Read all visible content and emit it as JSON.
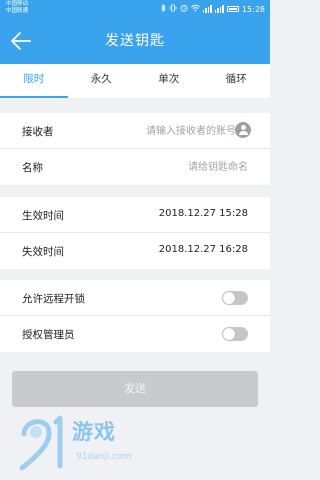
{
  "status_bar": {
    "carrier_1": "中国移动",
    "carrier_2": "中国联通",
    "time": "15:28"
  },
  "header": {
    "title": "发送钥匙",
    "back_icon": "arrow-left-icon"
  },
  "tabs": [
    {
      "label": "限时",
      "active": true
    },
    {
      "label": "永久",
      "active": false
    },
    {
      "label": "单次",
      "active": false
    },
    {
      "label": "循环",
      "active": false
    }
  ],
  "form": {
    "receiver": {
      "label": "接收者",
      "placeholder": "请输入接收者的账号",
      "icon": "contact-icon"
    },
    "name": {
      "label": "名称",
      "placeholder": "请给钥匙命名"
    },
    "start_time": {
      "label": "生效时间",
      "value": "2018.12.27 15:28"
    },
    "end_time": {
      "label": "失效时间",
      "value": "2018.12.27 16:28"
    },
    "remote_unlock": {
      "label": "允许远程开锁",
      "on": false
    },
    "admin": {
      "label": "授权管理员",
      "on": false
    }
  },
  "submit_label": "发送",
  "colors": {
    "accent": "#3aa3ee",
    "background": "#f0f1f4",
    "disabled_button": "#c9cacd",
    "toggle_off": "#c4c6ca"
  },
  "watermark": {
    "brand": "游戏",
    "domain": "91danji.com"
  }
}
